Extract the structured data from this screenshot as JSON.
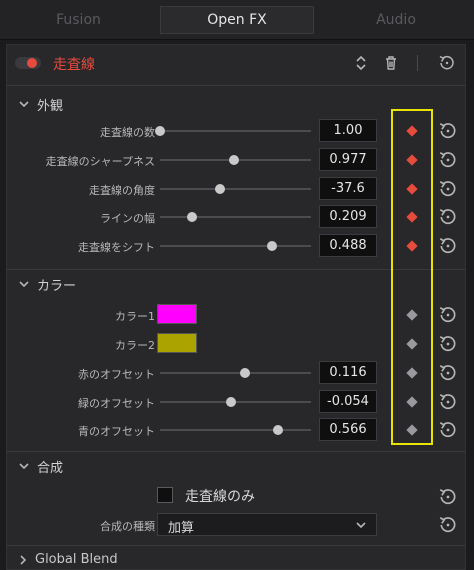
{
  "tabs": [
    {
      "label": "Fusion",
      "active": false
    },
    {
      "label": "Open FX",
      "active": true
    },
    {
      "label": "Audio",
      "active": false
    }
  ],
  "effect": {
    "title": "走査線",
    "enabled": true,
    "title_color": "#e64b3c"
  },
  "sections": {
    "appearance": {
      "title": "外観",
      "params": [
        {
          "label": "走査線の数",
          "value": "1.00",
          "level": 0.0,
          "keyframe": "red"
        },
        {
          "label": "走査線のシャープネス",
          "value": "0.977",
          "level": 0.49,
          "keyframe": "red"
        },
        {
          "label": "走査線の角度",
          "value": "-37.6",
          "level": 0.4,
          "keyframe": "red"
        },
        {
          "label": "ラインの幅",
          "value": "0.209",
          "level": 0.21,
          "keyframe": "red"
        },
        {
          "label": "走査線をシフト",
          "value": "0.488",
          "level": 0.74,
          "keyframe": "red"
        }
      ]
    },
    "color": {
      "title": "カラー",
      "swatches": [
        {
          "label": "カラー1",
          "color": "#ff00ff",
          "keyframe": "grey"
        },
        {
          "label": "カラー2",
          "color": "#aaa300",
          "keyframe": "grey"
        }
      ],
      "params": [
        {
          "label": "赤のオフセット",
          "value": "0.116",
          "level": 0.56,
          "keyframe": "grey"
        },
        {
          "label": "緑のオフセット",
          "value": "-0.054",
          "level": 0.47,
          "keyframe": "grey"
        },
        {
          "label": "青のオフセット",
          "value": "0.566",
          "level": 0.78,
          "keyframe": "grey"
        }
      ]
    },
    "composite": {
      "title": "合成",
      "checkbox_label": "走査線のみ",
      "checkbox_checked": false,
      "mode_label": "合成の種類",
      "mode_value": "加算"
    },
    "global_blend": {
      "title": "Global Blend"
    }
  },
  "colors": {
    "keyframe_active": "#e64b3c",
    "keyframe_inactive": "#9a9a9e",
    "highlight": "#e8e400"
  },
  "icons": [
    "chevron-up-down-icon",
    "trash-icon",
    "reset-icon",
    "chevron-down-icon",
    "chevron-right-icon",
    "keyframe-icon"
  ]
}
